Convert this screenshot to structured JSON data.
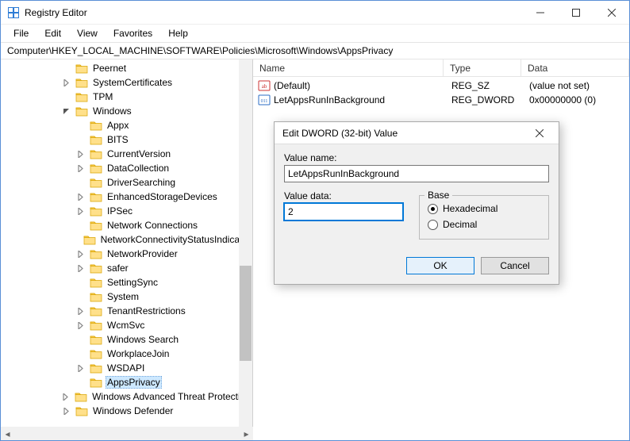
{
  "window": {
    "title": "Registry Editor"
  },
  "menu": {
    "file": "File",
    "edit": "Edit",
    "view": "View",
    "favorites": "Favorites",
    "help": "Help"
  },
  "address": "Computer\\HKEY_LOCAL_MACHINE\\SOFTWARE\\Policies\\Microsoft\\Windows\\AppsPrivacy",
  "tree": {
    "items": [
      {
        "label": "Peernet",
        "exp": "none",
        "depth": 0
      },
      {
        "label": "SystemCertificates",
        "exp": "closed",
        "depth": 0
      },
      {
        "label": "TPM",
        "exp": "none",
        "depth": 0
      },
      {
        "label": "Windows",
        "exp": "open",
        "depth": 0
      },
      {
        "label": "Appx",
        "exp": "none",
        "depth": 1
      },
      {
        "label": "BITS",
        "exp": "none",
        "depth": 1
      },
      {
        "label": "CurrentVersion",
        "exp": "closed",
        "depth": 1
      },
      {
        "label": "DataCollection",
        "exp": "closed",
        "depth": 1
      },
      {
        "label": "DriverSearching",
        "exp": "none",
        "depth": 1
      },
      {
        "label": "EnhancedStorageDevices",
        "exp": "closed",
        "depth": 1
      },
      {
        "label": "IPSec",
        "exp": "closed",
        "depth": 1
      },
      {
        "label": "Network Connections",
        "exp": "none",
        "depth": 1
      },
      {
        "label": "NetworkConnectivityStatusIndicator",
        "exp": "none",
        "depth": 1
      },
      {
        "label": "NetworkProvider",
        "exp": "closed",
        "depth": 1
      },
      {
        "label": "safer",
        "exp": "closed",
        "depth": 1
      },
      {
        "label": "SettingSync",
        "exp": "none",
        "depth": 1
      },
      {
        "label": "System",
        "exp": "none",
        "depth": 1
      },
      {
        "label": "TenantRestrictions",
        "exp": "closed",
        "depth": 1
      },
      {
        "label": "WcmSvc",
        "exp": "closed",
        "depth": 1
      },
      {
        "label": "Windows Search",
        "exp": "none",
        "depth": 1
      },
      {
        "label": "WorkplaceJoin",
        "exp": "none",
        "depth": 1
      },
      {
        "label": "WSDAPI",
        "exp": "closed",
        "depth": 1
      },
      {
        "label": "AppsPrivacy",
        "exp": "none",
        "depth": 1,
        "selected": true
      },
      {
        "label": "Windows Advanced Threat Protection",
        "exp": "closed",
        "depth": 0
      },
      {
        "label": "Windows Defender",
        "exp": "closed",
        "depth": 0
      }
    ]
  },
  "list": {
    "headers": {
      "name": "Name",
      "type": "Type",
      "data": "Data"
    },
    "rows": [
      {
        "icon": "sz",
        "name": "(Default)",
        "type": "REG_SZ",
        "data": "(value not set)"
      },
      {
        "icon": "dw",
        "name": "LetAppsRunInBackground",
        "type": "REG_DWORD",
        "data": "0x00000000 (0)"
      }
    ]
  },
  "dialog": {
    "title": "Edit DWORD (32-bit) Value",
    "value_name_label": "Value name:",
    "value_name": "LetAppsRunInBackground",
    "value_data_label": "Value data:",
    "value_data": "2",
    "base_label": "Base",
    "hex_label": "Hexadecimal",
    "dec_label": "Decimal",
    "base_selected": "hex",
    "ok": "OK",
    "cancel": "Cancel"
  }
}
